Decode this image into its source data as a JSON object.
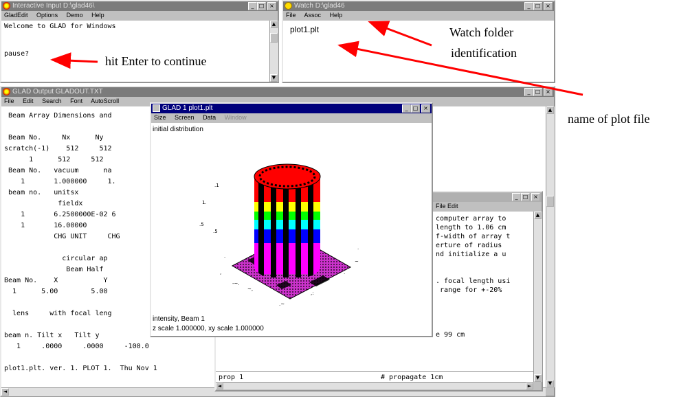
{
  "interactive_window": {
    "title": "Interactive Input D:\\glad46\\",
    "menu": [
      "GladEdit",
      "Options",
      "Demo",
      "Help"
    ],
    "lines": [
      "Welcome to GLAD for Windows",
      "",
      "pause?"
    ]
  },
  "watch_window": {
    "title": "Watch D:\\glad46",
    "menu": [
      "File",
      "Assoc",
      "Help"
    ],
    "items": [
      "plot1.plt"
    ]
  },
  "output_window": {
    "title": "GLAD Output GLADOUT.TXT",
    "menu": [
      "File",
      "Edit",
      "Search",
      "Font",
      "AutoScroll"
    ],
    "lines": [
      " Beam Array Dimensions and",
      "",
      " Beam No.     Nx      Ny",
      "scratch(-1)    512     512",
      "      1      512     512",
      " Beam No.   vacuum      na",
      "    1       1.000000     1.",
      " beam no.   unitsx",
      "             fieldx",
      "    1       6.2500000E-02 6",
      "    1       16.00000",
      "            CHG UNIT     CHG",
      "",
      "              circular ap",
      "               Beam Half",
      "Beam No.    X           Y",
      "  1      5.00        5.00",
      "",
      "  lens     with focal leng",
      "",
      "beam n. Tilt x   Tilt y",
      "   1     .0000     .0000     -100.0",
      "",
      "plot1.plt. ver. 1. PLOT 1.  Thu Nov 1"
    ]
  },
  "plot_window": {
    "title": "GLAD 1 plot1.plt",
    "menu": [
      "Size",
      "Screen",
      "Data",
      "Window"
    ],
    "caption_top": "initial distribution",
    "caption_bottom_1": "intensity, Beam 1",
    "caption_bottom_2": "z scale 1.000000, xy scale 1.000000"
  },
  "editor_window": {
    "title": "",
    "menu_tail": "File Edit",
    "lines": [
      "computer array to",
      "length to 1.06 cm",
      "f-width of array t",
      "erture of radius",
      "nd initialize a u",
      "",
      "",
      ". focal length usi",
      " range for +-20%",
      "",
      "",
      "",
      "",
      "e 99 cm",
      "",
      "",
      ""
    ],
    "bottom_left": "prop 1",
    "bottom_right": "# propagate 1cm"
  },
  "annotations": {
    "hit_enter": "hit Enter to continue",
    "watch_folder_1": "Watch folder",
    "watch_folder_2": "identification",
    "plot_file": "name of plot file"
  },
  "colors": {
    "active_title": "#00007b",
    "inactive_title": "#7b7b7b",
    "arrow": "#ff0000",
    "plot_magenta": "#cc33cc"
  }
}
